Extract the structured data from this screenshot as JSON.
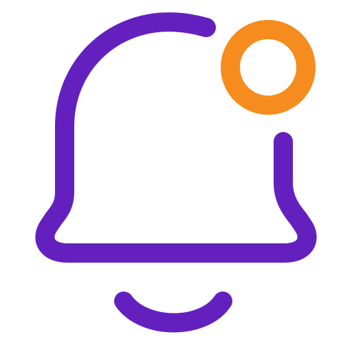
{
  "icon": {
    "name": "notification-bell-icon",
    "has_notification_dot": true
  },
  "colors": {
    "bell": "#6420BE",
    "dot": "#F68B1E",
    "background": "#FFFFFF"
  }
}
